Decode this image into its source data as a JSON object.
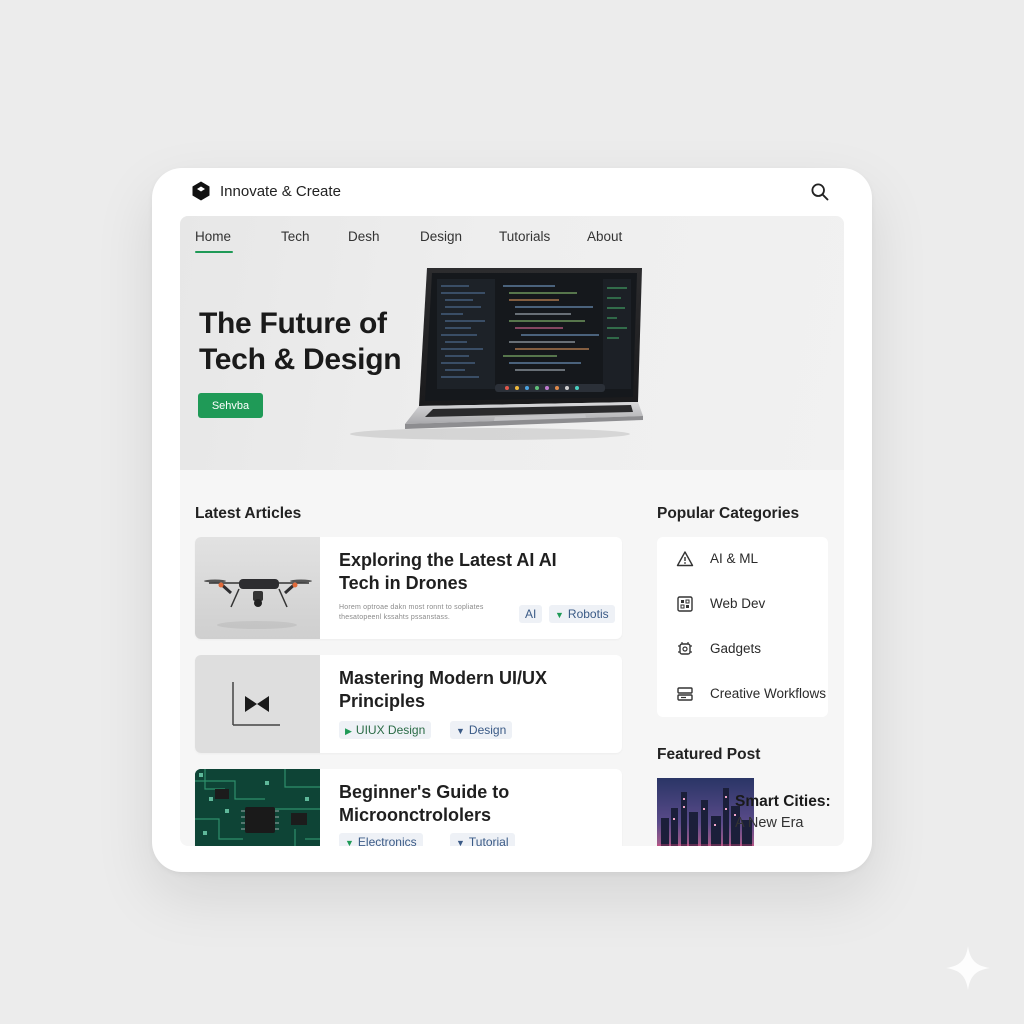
{
  "app": {
    "name": "Innovate & Create"
  },
  "nav": {
    "items": [
      {
        "label": "Home",
        "active": true
      },
      {
        "label": "Tech"
      },
      {
        "label": "Desh"
      },
      {
        "label": "Design"
      },
      {
        "label": "Tutorials"
      },
      {
        "label": "About"
      }
    ]
  },
  "hero": {
    "title": "The Future of Tech & Design",
    "cta_label": "Sehvba"
  },
  "latest": {
    "heading": "Latest Articles",
    "articles": [
      {
        "title": "Exploring the Latest AI AI Tech in Drones",
        "excerpt": "Horem optroae dakn most ronnt to sopliates thesatopeenl kssahts pssanstass.",
        "tags": [
          "AI",
          "Robotis"
        ],
        "thumb_icon": "drone-image"
      },
      {
        "title": "Mastering Modern UI/UX Principles",
        "tags": [
          "UIUX  Design",
          "Design"
        ],
        "thumb_icon": "ui-principles-image"
      },
      {
        "title": "Beginner's Guide to Microonctrololers",
        "tags": [
          "Electronics",
          "Tutorial"
        ],
        "thumb_icon": "circuit-board-image"
      }
    ]
  },
  "categories": {
    "heading": "Popular Categories",
    "items": [
      {
        "label": "AI & ML",
        "icon": "ai-ml-icon"
      },
      {
        "label": "Web Dev",
        "icon": "web-dev-icon"
      },
      {
        "label": "Gadgets",
        "icon": "gadgets-icon"
      },
      {
        "label": "Creative Workflows",
        "icon": "creative-workflows-icon"
      }
    ]
  },
  "featured": {
    "heading": "Featured Post",
    "title": "Smart Cities:",
    "subtitle": "A New Era"
  },
  "colors": {
    "accent": "#1f9a57",
    "tag_text": "#3a5a86",
    "background": "#ececec"
  }
}
